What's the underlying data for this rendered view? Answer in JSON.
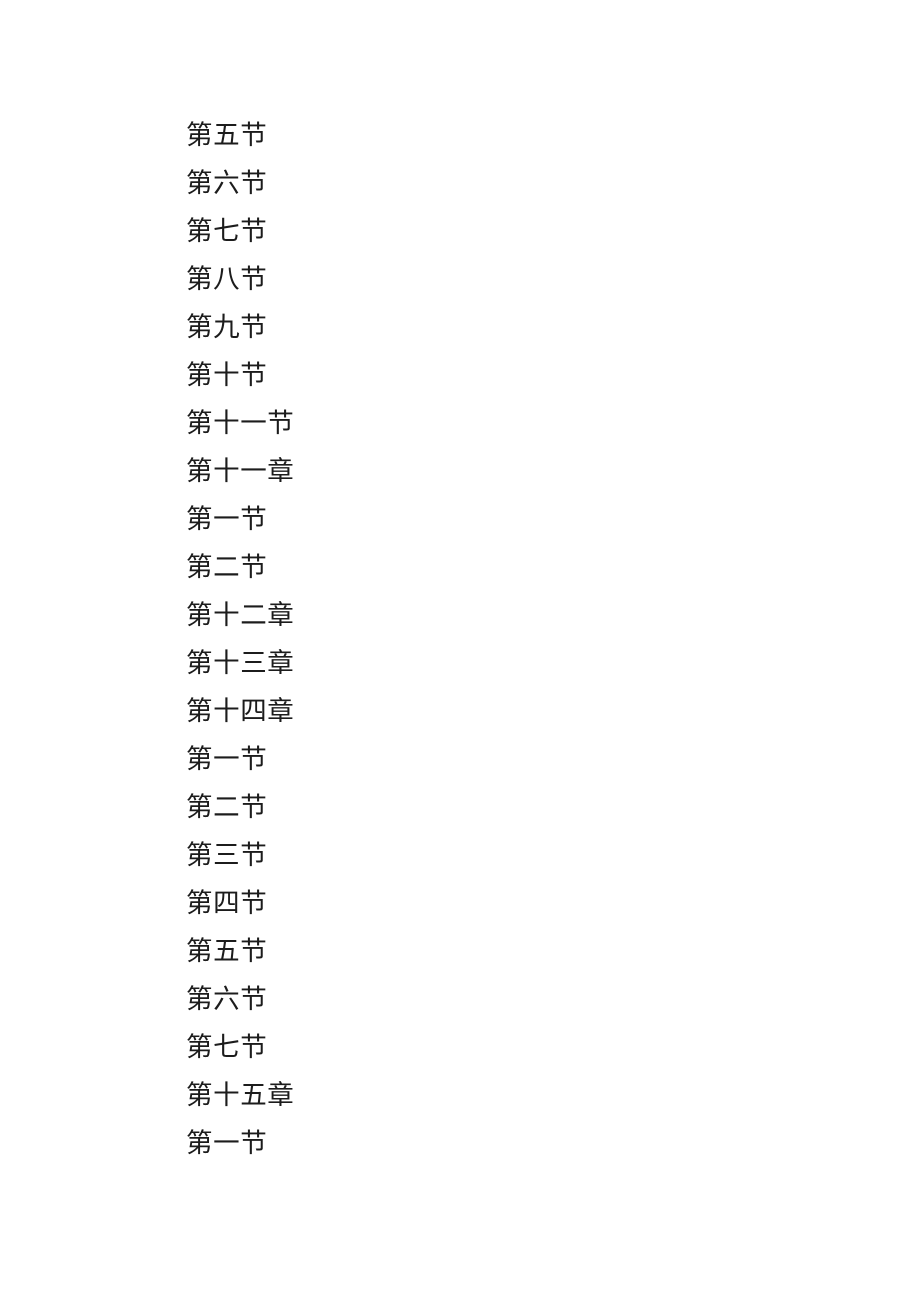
{
  "document": {
    "page_background": "#ffffff",
    "text_color": "#1c1c1c",
    "toc_entries": [
      {
        "text": "第五节"
      },
      {
        "text": "第六节"
      },
      {
        "text": "第七节"
      },
      {
        "text": "第八节"
      },
      {
        "text": "第九节"
      },
      {
        "text": "第十节"
      },
      {
        "text": "第十一节"
      },
      {
        "text": "第十一章"
      },
      {
        "text": "第一节"
      },
      {
        "text": "第二节"
      },
      {
        "text": "第十二章"
      },
      {
        "text": "第十三章"
      },
      {
        "text": "第十四章"
      },
      {
        "text": "第一节"
      },
      {
        "text": "第二节"
      },
      {
        "text": "第三节"
      },
      {
        "text": "第四节"
      },
      {
        "text": "第五节"
      },
      {
        "text": "第六节"
      },
      {
        "text": "第七节"
      },
      {
        "text": "第十五章"
      },
      {
        "text": "第一节"
      }
    ]
  }
}
